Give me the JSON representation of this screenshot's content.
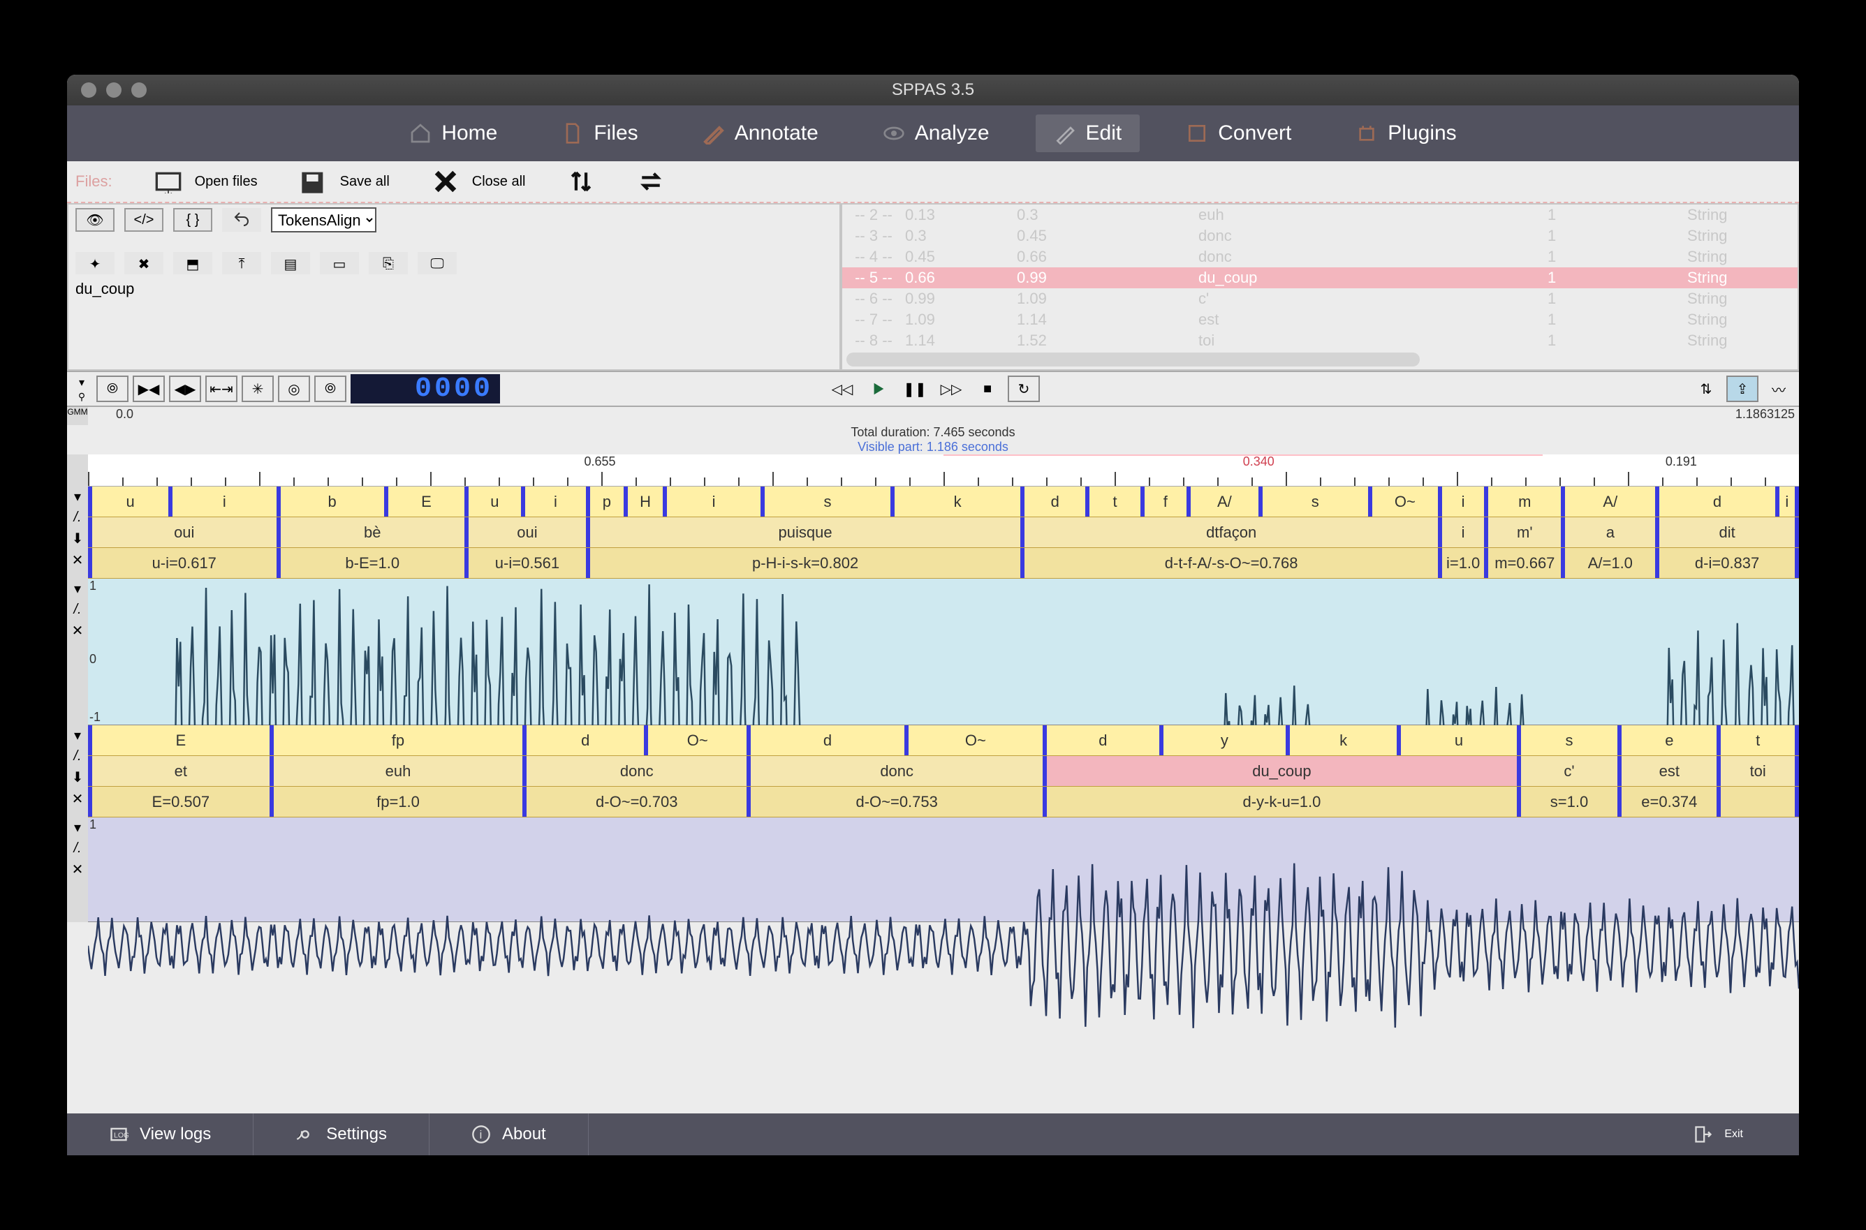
{
  "window": {
    "title": "SPPAS 3.5"
  },
  "nav": {
    "items": [
      {
        "label": "Home",
        "icon": "home-icon"
      },
      {
        "label": "Files",
        "icon": "file-icon"
      },
      {
        "label": "Annotate",
        "icon": "pencil-icon"
      },
      {
        "label": "Analyze",
        "icon": "eye-icon"
      },
      {
        "label": "Edit",
        "icon": "edit-icon",
        "active": true
      },
      {
        "label": "Convert",
        "icon": "convert-icon"
      },
      {
        "label": "Plugins",
        "icon": "plugin-icon"
      }
    ]
  },
  "filesbar": {
    "label": "Files:",
    "open": "Open files",
    "save": "Save all",
    "close": "Close all"
  },
  "editor": {
    "tier_selected": "TokensAlign",
    "text": "du_coup",
    "table": {
      "rows": [
        {
          "idx": "-- 2 --",
          "b": "0.13",
          "e": "0.3",
          "lab": "euh",
          "n": "1",
          "t": "String"
        },
        {
          "idx": "-- 3 --",
          "b": "0.3",
          "e": "0.45",
          "lab": "donc",
          "n": "1",
          "t": "String"
        },
        {
          "idx": "-- 4 --",
          "b": "0.45",
          "e": "0.66",
          "lab": "donc",
          "n": "1",
          "t": "String"
        },
        {
          "idx": "-- 5 --",
          "b": "0.66",
          "e": "0.99",
          "lab": "du_coup",
          "n": "1",
          "t": "String",
          "selected": true
        },
        {
          "idx": "-- 6 --",
          "b": "0.99",
          "e": "1.09",
          "lab": "c'",
          "n": "1",
          "t": "String"
        },
        {
          "idx": "-- 7 --",
          "b": "1.09",
          "e": "1.14",
          "lab": "est",
          "n": "1",
          "t": "String"
        },
        {
          "idx": "-- 8 --",
          "b": "1.14",
          "e": "1.52",
          "lab": "toi",
          "n": "1",
          "t": "String"
        }
      ]
    }
  },
  "player": {
    "lcd": "0000",
    "ruler_mini_left": "0.0",
    "ruler_mini_right": "1.1863125",
    "total_duration": "Total duration:  7.465 seconds",
    "visible_part": "Visible part:  1.186 seconds"
  },
  "ruler": {
    "red_mark": "0.340",
    "labels": [
      {
        "v": "0.655",
        "p": 29
      },
      {
        "v": "0.191",
        "p": 92.2
      }
    ],
    "pink_start": 50,
    "pink_end": 85
  },
  "tiers_top": {
    "phones": [
      {
        "l": "u",
        "s": 0,
        "e": 4.7
      },
      {
        "l": "i",
        "s": 4.7,
        "e": 11
      },
      {
        "l": "b",
        "s": 11,
        "e": 17.3
      },
      {
        "l": "E",
        "s": 17.3,
        "e": 22
      },
      {
        "l": "u",
        "s": 22,
        "e": 25.3
      },
      {
        "l": "i",
        "s": 25.3,
        "e": 29.1
      },
      {
        "l": "p",
        "s": 29.1,
        "e": 31.3
      },
      {
        "l": "H",
        "s": 31.3,
        "e": 33.6
      },
      {
        "l": "i",
        "s": 33.6,
        "e": 39.3
      },
      {
        "l": "s",
        "s": 39.3,
        "e": 46.9
      },
      {
        "l": "k",
        "s": 46.9,
        "e": 54.5
      },
      {
        "l": "d",
        "s": 54.5,
        "e": 58.3
      },
      {
        "l": "t",
        "s": 58.3,
        "e": 61.5
      },
      {
        "l": "f",
        "s": 61.5,
        "e": 64.2
      },
      {
        "l": "A/",
        "s": 64.2,
        "e": 68.4
      },
      {
        "l": "s",
        "s": 68.4,
        "e": 74.8
      },
      {
        "l": "O~",
        "s": 74.8,
        "e": 78.9
      },
      {
        "l": "i",
        "s": 78.9,
        "e": 81.6
      },
      {
        "l": "m",
        "s": 81.6,
        "e": 86.1
      },
      {
        "l": "A/",
        "s": 86.1,
        "e": 91.6
      },
      {
        "l": "d",
        "s": 91.6,
        "e": 98.6
      },
      {
        "l": "i",
        "s": 98.6,
        "e": 100
      }
    ],
    "tokens": [
      {
        "l": "oui",
        "s": 0,
        "e": 11
      },
      {
        "l": "bè",
        "s": 11,
        "e": 22
      },
      {
        "l": "oui",
        "s": 22,
        "e": 29.1
      },
      {
        "l": "puisque",
        "s": 29.1,
        "e": 54.5
      },
      {
        "l": "dtfaçon",
        "s": 54.5,
        "e": 78.9
      },
      {
        "l": "i",
        "s": 78.9,
        "e": 81.6
      },
      {
        "l": "m'",
        "s": 81.6,
        "e": 86.1
      },
      {
        "l": "a",
        "s": 86.1,
        "e": 91.6
      },
      {
        "l": "dit",
        "s": 91.6,
        "e": 100
      }
    ],
    "align": [
      {
        "l": "u-i=0.617",
        "s": 0,
        "e": 11
      },
      {
        "l": "b-E=1.0",
        "s": 11,
        "e": 22
      },
      {
        "l": "u-i=0.561",
        "s": 22,
        "e": 29.1
      },
      {
        "l": "p-H-i-s-k=0.802",
        "s": 29.1,
        "e": 54.5
      },
      {
        "l": "d-t-f-A/-s-O~=0.768",
        "s": 54.5,
        "e": 78.9
      },
      {
        "l": "i=1.0",
        "s": 78.9,
        "e": 81.6
      },
      {
        "l": "m=0.667",
        "s": 81.6,
        "e": 86.1
      },
      {
        "l": "A/=1.0",
        "s": 86.1,
        "e": 91.6
      },
      {
        "l": "d-i=0.837",
        "s": 91.6,
        "e": 100
      }
    ]
  },
  "tiers_bottom": {
    "phones": [
      {
        "l": "E",
        "s": 0,
        "e": 10.6
      },
      {
        "l": "fp",
        "s": 10.6,
        "e": 25.4
      },
      {
        "l": "d",
        "s": 25.4,
        "e": 32.5
      },
      {
        "l": "O~",
        "s": 32.5,
        "e": 38.5
      },
      {
        "l": "d",
        "s": 38.5,
        "e": 47.7
      },
      {
        "l": "O~",
        "s": 47.7,
        "e": 55.8
      },
      {
        "l": "d",
        "s": 55.8,
        "e": 62.6
      },
      {
        "l": "y",
        "s": 62.6,
        "e": 70
      },
      {
        "l": "k",
        "s": 70,
        "e": 76.5
      },
      {
        "l": "u",
        "s": 76.5,
        "e": 83.5
      },
      {
        "l": "s",
        "s": 83.5,
        "e": 89.4
      },
      {
        "l": "e",
        "s": 89.4,
        "e": 95.2
      },
      {
        "l": "t",
        "s": 95.2,
        "e": 100
      }
    ],
    "tokens": [
      {
        "l": "et",
        "s": 0,
        "e": 10.6
      },
      {
        "l": "euh",
        "s": 10.6,
        "e": 25.4
      },
      {
        "l": "donc",
        "s": 25.4,
        "e": 38.5
      },
      {
        "l": "donc",
        "s": 38.5,
        "e": 55.8
      },
      {
        "l": "du_coup",
        "s": 55.8,
        "e": 83.5,
        "pink": true
      },
      {
        "l": "c'",
        "s": 83.5,
        "e": 89.4
      },
      {
        "l": "est",
        "s": 89.4,
        "e": 95.2
      },
      {
        "l": "toi",
        "s": 95.2,
        "e": 100
      }
    ],
    "align": [
      {
        "l": "E=0.507",
        "s": 0,
        "e": 10.6
      },
      {
        "l": "fp=1.0",
        "s": 10.6,
        "e": 25.4
      },
      {
        "l": "d-O~=0.703",
        "s": 25.4,
        "e": 38.5
      },
      {
        "l": "d-O~=0.753",
        "s": 38.5,
        "e": 55.8
      },
      {
        "l": "d-y-k-u=1.0",
        "s": 55.8,
        "e": 83.5
      },
      {
        "l": "s=1.0",
        "s": 83.5,
        "e": 89.4
      },
      {
        "l": "e=0.374",
        "s": 89.4,
        "e": 95.2
      },
      {
        "l": "",
        "s": 95.2,
        "e": 100
      }
    ]
  },
  "wave_labels": {
    "plus1": "1",
    "zero": "0",
    "minus1": "-1"
  },
  "footer": {
    "view_logs": "View logs",
    "settings": "Settings",
    "about": "About",
    "exit": "Exit"
  }
}
